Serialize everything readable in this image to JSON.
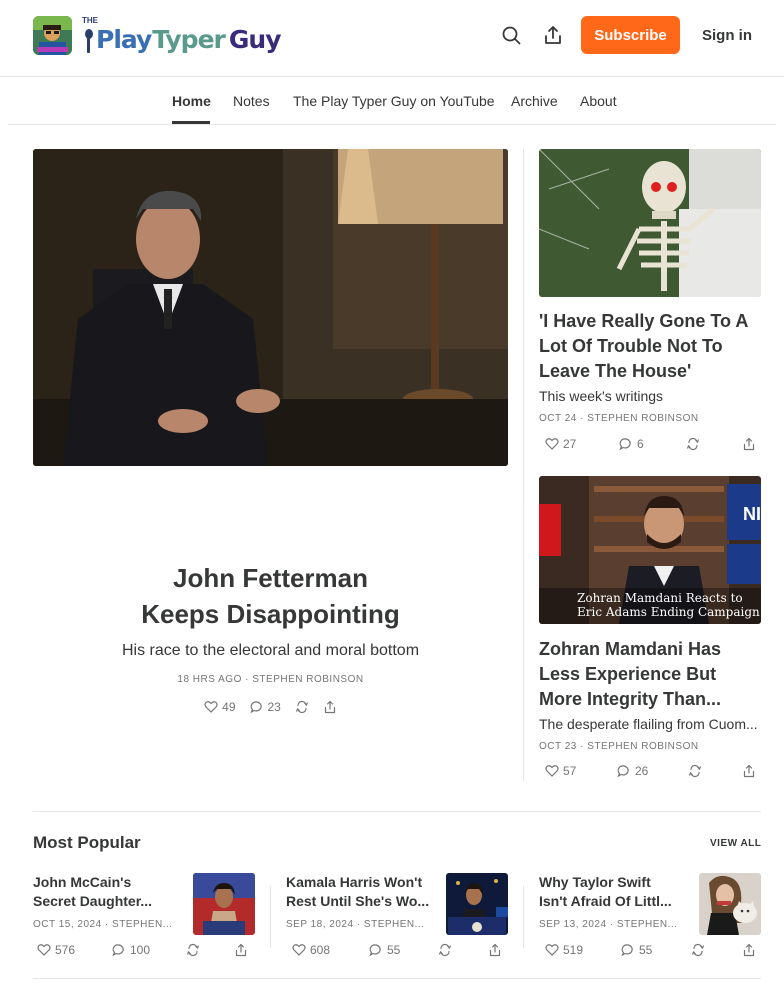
{
  "header": {
    "logo_the": "THE",
    "logo_words": [
      "Play",
      "Typer",
      "Guy"
    ],
    "logo_colors": [
      "#3a6fb4",
      "#4f8fd6",
      "#3a2b7a"
    ],
    "subscribe_label": "Subscribe",
    "signin_label": "Sign in",
    "accent": "#ff6719"
  },
  "nav": {
    "items": [
      "Home",
      "Notes",
      "The Play Typer Guy on YouTube",
      "Archive",
      "About"
    ],
    "active": "Home"
  },
  "hero": {
    "title_line1": "John Fetterman",
    "title_line2": "Keeps Disappointing",
    "subtitle": "His race to the electoral and moral bottom",
    "meta": "18 HRS AGO · STEPHEN ROBINSON",
    "likes": "49",
    "comments": "23"
  },
  "side": [
    {
      "title": "'I Have Really Gone To A Lot Of Trouble Not To Leave The House'",
      "subtitle": "This week's writings",
      "meta": "OCT 24 · STEPHEN ROBINSON",
      "likes": "27",
      "comments": "6"
    },
    {
      "title": "Zohran Mamdani Has Less Experience But More Integrity Than...",
      "subtitle": "The desperate flailing from Cuom...",
      "meta": "OCT 23 · STEPHEN ROBINSON",
      "likes": "57",
      "comments": "26",
      "image_caption_line1": "Zohran Mamdani Reacts to",
      "image_caption_line2": "Eric Adams Ending Campaign",
      "image_side_text": "NI"
    }
  ],
  "popular": {
    "heading": "Most Popular",
    "view_all": "VIEW ALL",
    "items": [
      {
        "title_line1": "John McCain's",
        "title_line2": "Secret Daughter...",
        "meta": "OCT 15, 2024 · STEPHEN...",
        "likes": "576",
        "comments": "100"
      },
      {
        "title_line1": "Kamala Harris Won't",
        "title_line2": "Rest Until She's Wo...",
        "meta": "SEP 18, 2024 · STEPHEN...",
        "likes": "608",
        "comments": "55"
      },
      {
        "title_line1": "Why Taylor Swift",
        "title_line2": "Isn't Afraid Of Littl...",
        "meta": "SEP 13, 2024 · STEPHEN...",
        "likes": "519",
        "comments": "55"
      }
    ]
  }
}
